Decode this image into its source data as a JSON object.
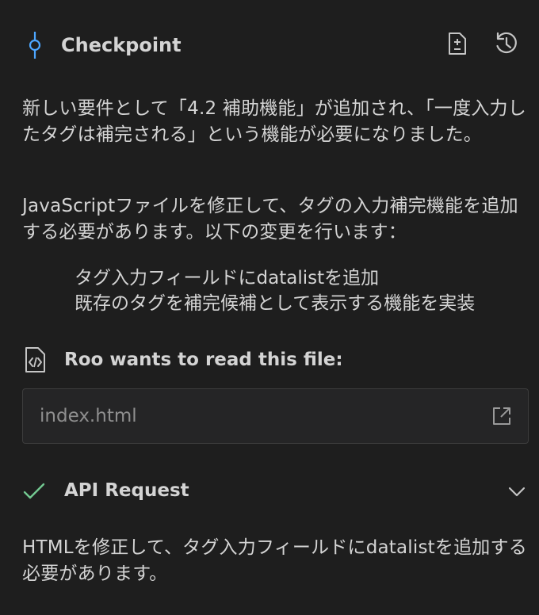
{
  "checkpoint": {
    "label": "Checkpoint",
    "accent_color": "#4da6ff",
    "diff_icon": "file-diff-icon",
    "restore_icon": "history-icon"
  },
  "messages": {
    "para1": "新しい要件として「4.2 補助機能」が追加され、「一度入力したタグは補完される」という機能が必要になりました。",
    "para2": "JavaScriptファイルを修正して、タグの入力補完機能を追加する必要があります。以下の変更を行います：",
    "list": [
      "タグ入力フィールドにdatalistを追加",
      "既存のタグを補完候補として表示する機能を実装"
    ],
    "para3": "HTMLを修正して、タグ入力フィールドにdatalistを追加する必要があります。"
  },
  "tool": {
    "label": "Roo wants to read this file:",
    "icon": "file-code-icon",
    "file_path": "index.html",
    "open_icon": "link-external-icon"
  },
  "api_request": {
    "label": "API Request",
    "status_icon": "check-icon",
    "status_color": "#73c991",
    "expand_icon": "chevron-down-icon"
  }
}
